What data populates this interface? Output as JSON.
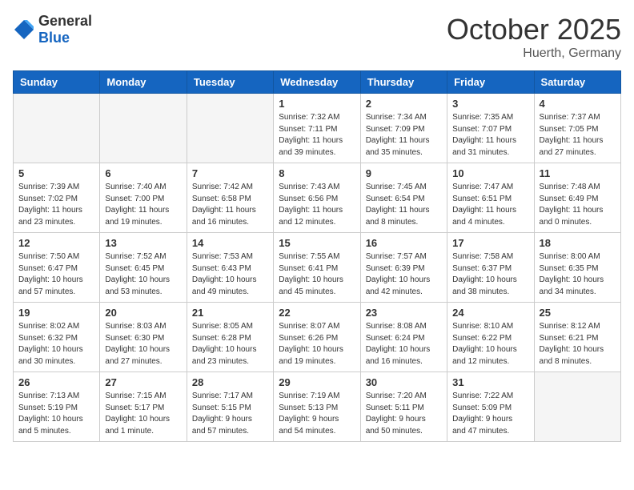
{
  "header": {
    "logo_general": "General",
    "logo_blue": "Blue",
    "month": "October 2025",
    "location": "Huerth, Germany"
  },
  "weekdays": [
    "Sunday",
    "Monday",
    "Tuesday",
    "Wednesday",
    "Thursday",
    "Friday",
    "Saturday"
  ],
  "weeks": [
    [
      {
        "day": "",
        "info": ""
      },
      {
        "day": "",
        "info": ""
      },
      {
        "day": "",
        "info": ""
      },
      {
        "day": "1",
        "info": "Sunrise: 7:32 AM\nSunset: 7:11 PM\nDaylight: 11 hours\nand 39 minutes."
      },
      {
        "day": "2",
        "info": "Sunrise: 7:34 AM\nSunset: 7:09 PM\nDaylight: 11 hours\nand 35 minutes."
      },
      {
        "day": "3",
        "info": "Sunrise: 7:35 AM\nSunset: 7:07 PM\nDaylight: 11 hours\nand 31 minutes."
      },
      {
        "day": "4",
        "info": "Sunrise: 7:37 AM\nSunset: 7:05 PM\nDaylight: 11 hours\nand 27 minutes."
      }
    ],
    [
      {
        "day": "5",
        "info": "Sunrise: 7:39 AM\nSunset: 7:02 PM\nDaylight: 11 hours\nand 23 minutes."
      },
      {
        "day": "6",
        "info": "Sunrise: 7:40 AM\nSunset: 7:00 PM\nDaylight: 11 hours\nand 19 minutes."
      },
      {
        "day": "7",
        "info": "Sunrise: 7:42 AM\nSunset: 6:58 PM\nDaylight: 11 hours\nand 16 minutes."
      },
      {
        "day": "8",
        "info": "Sunrise: 7:43 AM\nSunset: 6:56 PM\nDaylight: 11 hours\nand 12 minutes."
      },
      {
        "day": "9",
        "info": "Sunrise: 7:45 AM\nSunset: 6:54 PM\nDaylight: 11 hours\nand 8 minutes."
      },
      {
        "day": "10",
        "info": "Sunrise: 7:47 AM\nSunset: 6:51 PM\nDaylight: 11 hours\nand 4 minutes."
      },
      {
        "day": "11",
        "info": "Sunrise: 7:48 AM\nSunset: 6:49 PM\nDaylight: 11 hours\nand 0 minutes."
      }
    ],
    [
      {
        "day": "12",
        "info": "Sunrise: 7:50 AM\nSunset: 6:47 PM\nDaylight: 10 hours\nand 57 minutes."
      },
      {
        "day": "13",
        "info": "Sunrise: 7:52 AM\nSunset: 6:45 PM\nDaylight: 10 hours\nand 53 minutes."
      },
      {
        "day": "14",
        "info": "Sunrise: 7:53 AM\nSunset: 6:43 PM\nDaylight: 10 hours\nand 49 minutes."
      },
      {
        "day": "15",
        "info": "Sunrise: 7:55 AM\nSunset: 6:41 PM\nDaylight: 10 hours\nand 45 minutes."
      },
      {
        "day": "16",
        "info": "Sunrise: 7:57 AM\nSunset: 6:39 PM\nDaylight: 10 hours\nand 42 minutes."
      },
      {
        "day": "17",
        "info": "Sunrise: 7:58 AM\nSunset: 6:37 PM\nDaylight: 10 hours\nand 38 minutes."
      },
      {
        "day": "18",
        "info": "Sunrise: 8:00 AM\nSunset: 6:35 PM\nDaylight: 10 hours\nand 34 minutes."
      }
    ],
    [
      {
        "day": "19",
        "info": "Sunrise: 8:02 AM\nSunset: 6:32 PM\nDaylight: 10 hours\nand 30 minutes."
      },
      {
        "day": "20",
        "info": "Sunrise: 8:03 AM\nSunset: 6:30 PM\nDaylight: 10 hours\nand 27 minutes."
      },
      {
        "day": "21",
        "info": "Sunrise: 8:05 AM\nSunset: 6:28 PM\nDaylight: 10 hours\nand 23 minutes."
      },
      {
        "day": "22",
        "info": "Sunrise: 8:07 AM\nSunset: 6:26 PM\nDaylight: 10 hours\nand 19 minutes."
      },
      {
        "day": "23",
        "info": "Sunrise: 8:08 AM\nSunset: 6:24 PM\nDaylight: 10 hours\nand 16 minutes."
      },
      {
        "day": "24",
        "info": "Sunrise: 8:10 AM\nSunset: 6:22 PM\nDaylight: 10 hours\nand 12 minutes."
      },
      {
        "day": "25",
        "info": "Sunrise: 8:12 AM\nSunset: 6:21 PM\nDaylight: 10 hours\nand 8 minutes."
      }
    ],
    [
      {
        "day": "26",
        "info": "Sunrise: 7:13 AM\nSunset: 5:19 PM\nDaylight: 10 hours\nand 5 minutes."
      },
      {
        "day": "27",
        "info": "Sunrise: 7:15 AM\nSunset: 5:17 PM\nDaylight: 10 hours\nand 1 minute."
      },
      {
        "day": "28",
        "info": "Sunrise: 7:17 AM\nSunset: 5:15 PM\nDaylight: 9 hours\nand 57 minutes."
      },
      {
        "day": "29",
        "info": "Sunrise: 7:19 AM\nSunset: 5:13 PM\nDaylight: 9 hours\nand 54 minutes."
      },
      {
        "day": "30",
        "info": "Sunrise: 7:20 AM\nSunset: 5:11 PM\nDaylight: 9 hours\nand 50 minutes."
      },
      {
        "day": "31",
        "info": "Sunrise: 7:22 AM\nSunset: 5:09 PM\nDaylight: 9 hours\nand 47 minutes."
      },
      {
        "day": "",
        "info": ""
      }
    ]
  ]
}
